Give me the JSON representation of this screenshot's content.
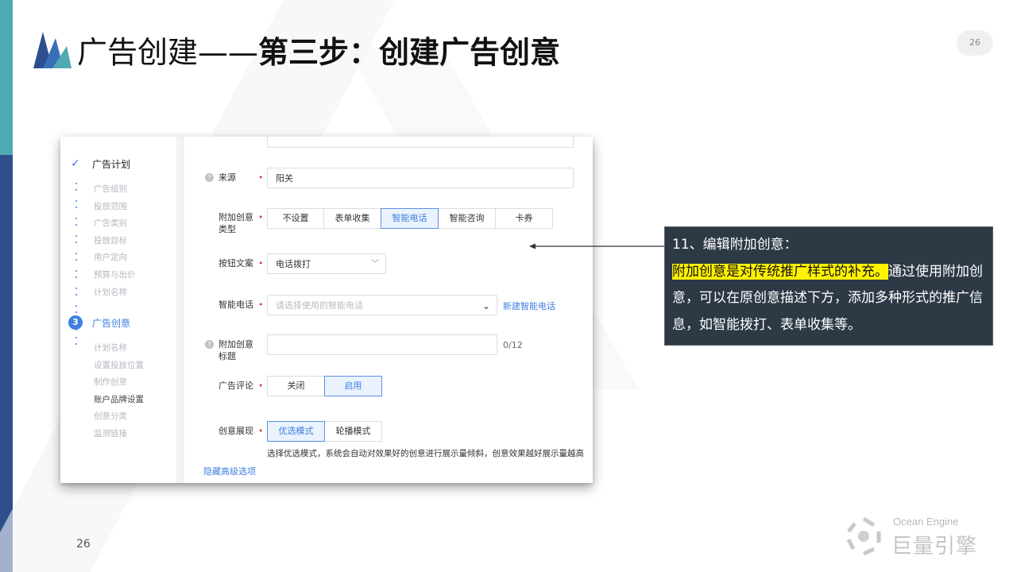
{
  "slide": {
    "title_light": "广告创建——",
    "title_bold": "第三步：创建广告创意",
    "page_badge": "26",
    "page_number": "26"
  },
  "sidebar": {
    "plan_heading": "广告计划",
    "plan_items": [
      "广告组别",
      "投放范围",
      "广告类别",
      "投放目标",
      "用户定向",
      "预算与出价",
      "计划名称"
    ],
    "creative_step": "3",
    "creative_heading": "广告创意",
    "creative_items": [
      "计划名称",
      "设置投放位置",
      "制作创意",
      "账户品牌设置",
      "创意分类",
      "监测链接"
    ]
  },
  "form": {
    "source_label": "来源",
    "source_value": "阳关",
    "extra_type_label": "附加创意类型",
    "extra_type_options": [
      "不设置",
      "表单收集",
      "智能电话",
      "智能咨询",
      "卡券"
    ],
    "extra_type_selected": "智能电话",
    "button_text_label": "按钮文案",
    "button_text_value": "电话拨打",
    "smart_phone_label": "智能电话",
    "smart_phone_placeholder": "请选择使用的智能电话",
    "new_smart_phone_link": "新建智能电话",
    "extra_title_label": "附加创意标题",
    "extra_title_counter": "0/12",
    "comment_label": "广告评论",
    "comment_options": [
      "关闭",
      "启用"
    ],
    "comment_selected": "启用",
    "display_label": "创意展现",
    "display_options": [
      "优选模式",
      "轮播模式"
    ],
    "display_selected": "优选模式",
    "display_hint": "选择优选模式，系统会自动对效果好的创意进行展示量倾斜，创意效果越好展示量越高",
    "hide_advanced_link": "隐藏高级选项"
  },
  "callout": {
    "heading": "11、编辑附加创意：",
    "highlight": "附加创意是对传统推广样式的补充。",
    "body": "通过使用附加创意，可以在原创意描述下方，添加多种形式的推广信息，如智能拨打、表单收集等。"
  },
  "brand": {
    "english": "Ocean Engine",
    "chinese": "巨量引擎"
  },
  "colors": {
    "accent_blue": "#3f7fe0",
    "sidebar_dark": "#2e4f8e",
    "sidebar_teal": "#4fa9b3",
    "callout_bg": "#2e3946",
    "highlight": "#fff200"
  }
}
